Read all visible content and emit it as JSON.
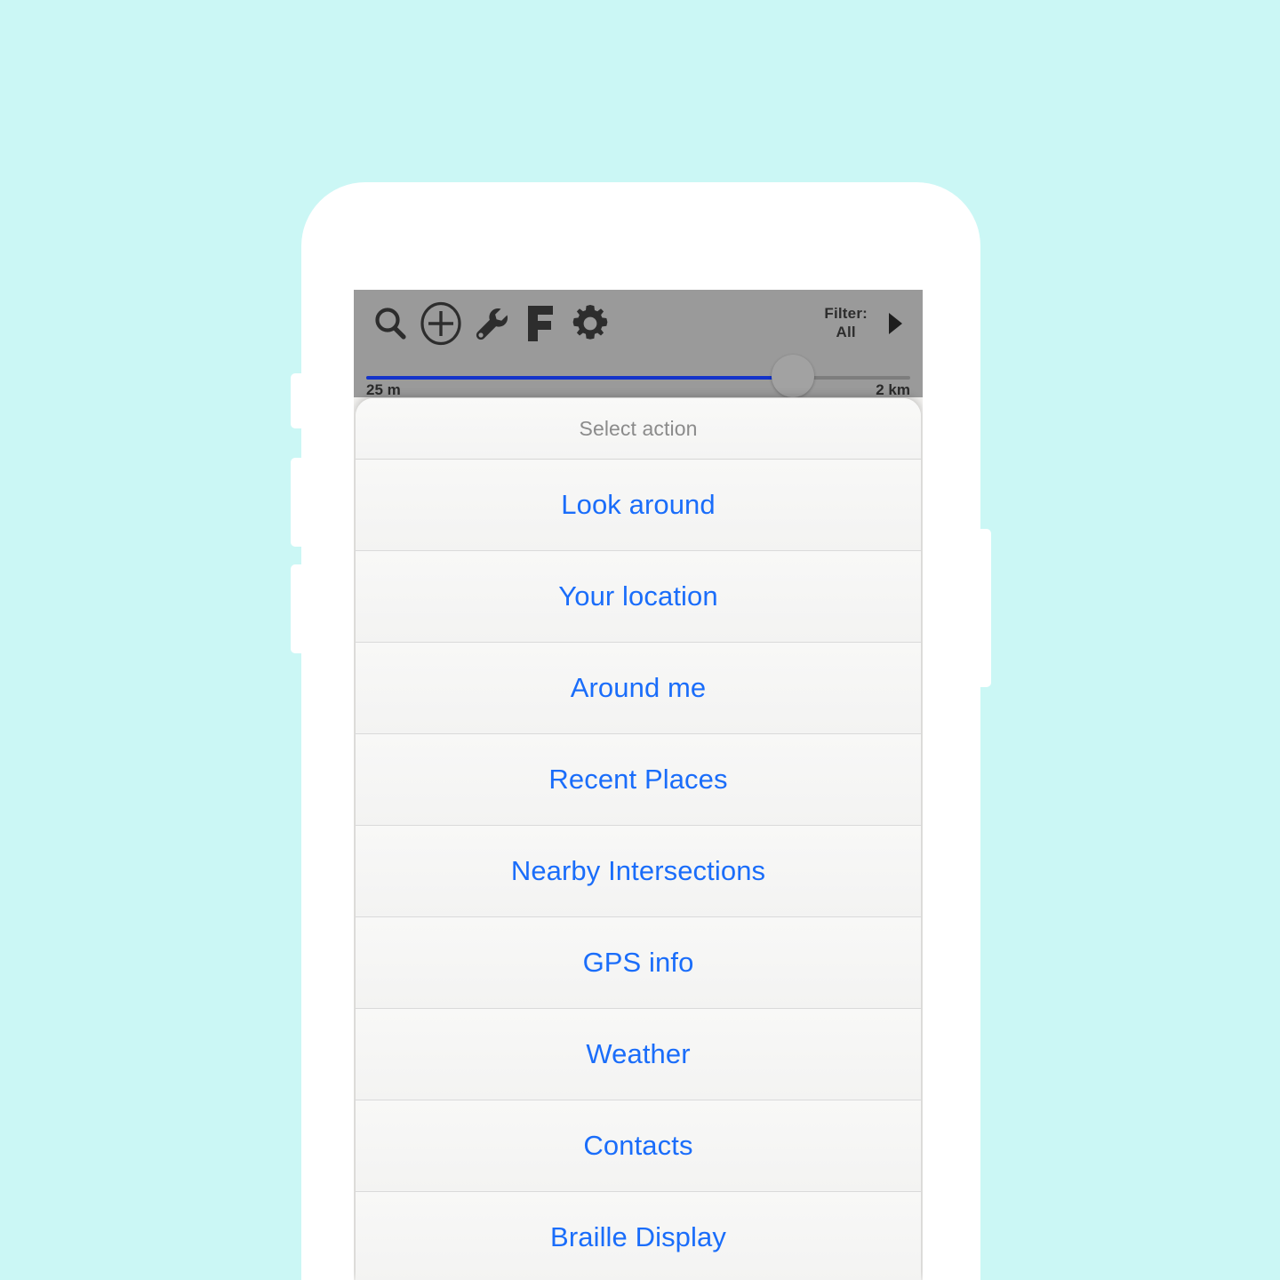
{
  "background_color": "#cbf7f5",
  "accent_color": "#1a6dfa",
  "device": {
    "frame_color": "#ffffff"
  },
  "map_toolbar": {
    "background_color": "#9a9a9a",
    "icons": [
      {
        "name": "search-icon",
        "label": "Search"
      },
      {
        "name": "add-circle-icon",
        "label": "Add"
      },
      {
        "name": "wrench-icon",
        "label": "Tools"
      },
      {
        "name": "favorites-f-icon",
        "label": "F"
      },
      {
        "name": "gear-icon",
        "label": "Settings"
      }
    ],
    "filter": {
      "label": "Filter:",
      "value": "All",
      "arrow_icon": "triangle-right-icon"
    }
  },
  "zoom_slider": {
    "min_label": "25 m",
    "max_label": "2 km",
    "fill_color": "#1333c9",
    "value_percent": 77
  },
  "action_sheet": {
    "title": "Select action",
    "items": [
      {
        "label": "Look around"
      },
      {
        "label": "Your location"
      },
      {
        "label": "Around me"
      },
      {
        "label": "Recent Places"
      },
      {
        "label": "Nearby Intersections"
      },
      {
        "label": "GPS info"
      },
      {
        "label": "Weather"
      },
      {
        "label": "Contacts"
      },
      {
        "label": "Braille Display"
      }
    ]
  }
}
